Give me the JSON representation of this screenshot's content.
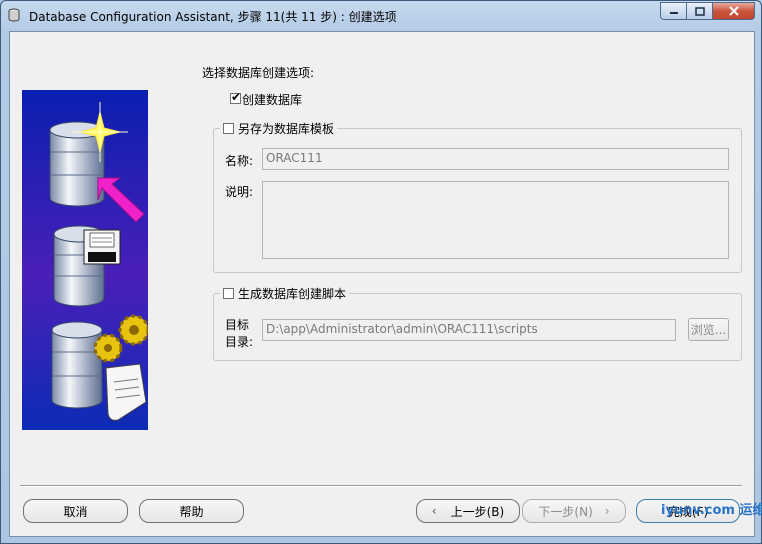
{
  "window": {
    "title": "Database Configuration Assistant, 步骤 11(共 11 步) : 创建选项"
  },
  "main": {
    "heading": "选择数据库创建选项:",
    "create_db": {
      "label": "创建数据库",
      "checked": true
    },
    "template_group": {
      "label": "另存为数据库模板",
      "checked": false,
      "name_label": "名称:",
      "name_value": "ORAC111",
      "desc_label": "说明:",
      "desc_value": ""
    },
    "script_group": {
      "label": "生成数据库创建脚本",
      "checked": false,
      "dir_label_line1": "目标",
      "dir_label_line2": "目录:",
      "dir_value": "D:\\app\\Administrator\\admin\\ORAC111\\scripts",
      "browse_label": "浏览..."
    }
  },
  "footer": {
    "cancel": "取消",
    "help": "帮助",
    "back": "上一步(B)",
    "next": "下一步(N)",
    "finish": "完成(F)"
  },
  "watermark": "iyunv.com 运维网"
}
